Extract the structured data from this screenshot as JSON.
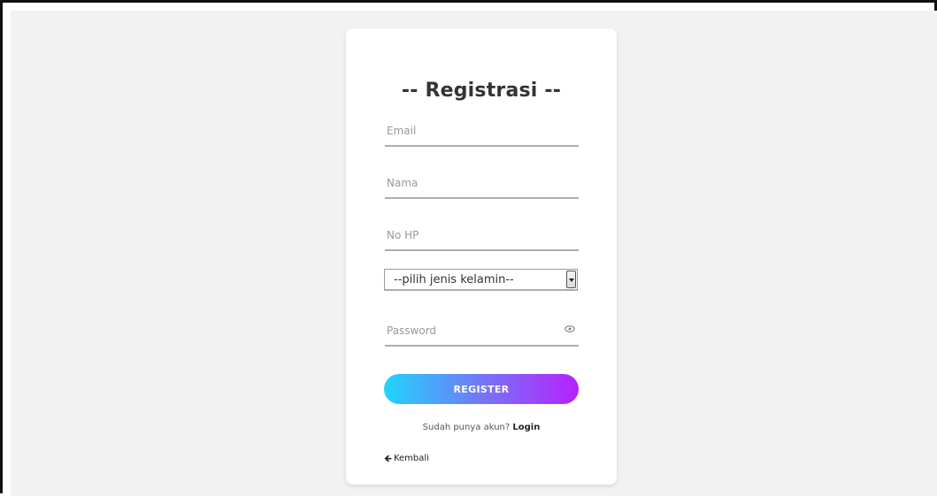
{
  "form": {
    "title": "-- Registrasi --",
    "email": {
      "placeholder": "Email",
      "value": ""
    },
    "nama": {
      "placeholder": "Nama",
      "value": ""
    },
    "no_hp": {
      "placeholder": "No HP",
      "value": ""
    },
    "gender_select": {
      "selected": "--pilih jenis kelamin--"
    },
    "password": {
      "placeholder": "Password",
      "value": "",
      "toggle_icon": "eye-icon"
    },
    "register_label": "REGISTER",
    "login_prompt": "Sudah punya akun?",
    "login_label": "Login",
    "back_icon": "arrow-left-icon",
    "back_label": "Kembali"
  },
  "colors": {
    "page_bg": "#f2f2f2",
    "card_bg": "#ffffff",
    "button_gradient_start": "#21d4fd",
    "button_gradient_end": "#b721ff",
    "underline": "#adadad"
  }
}
